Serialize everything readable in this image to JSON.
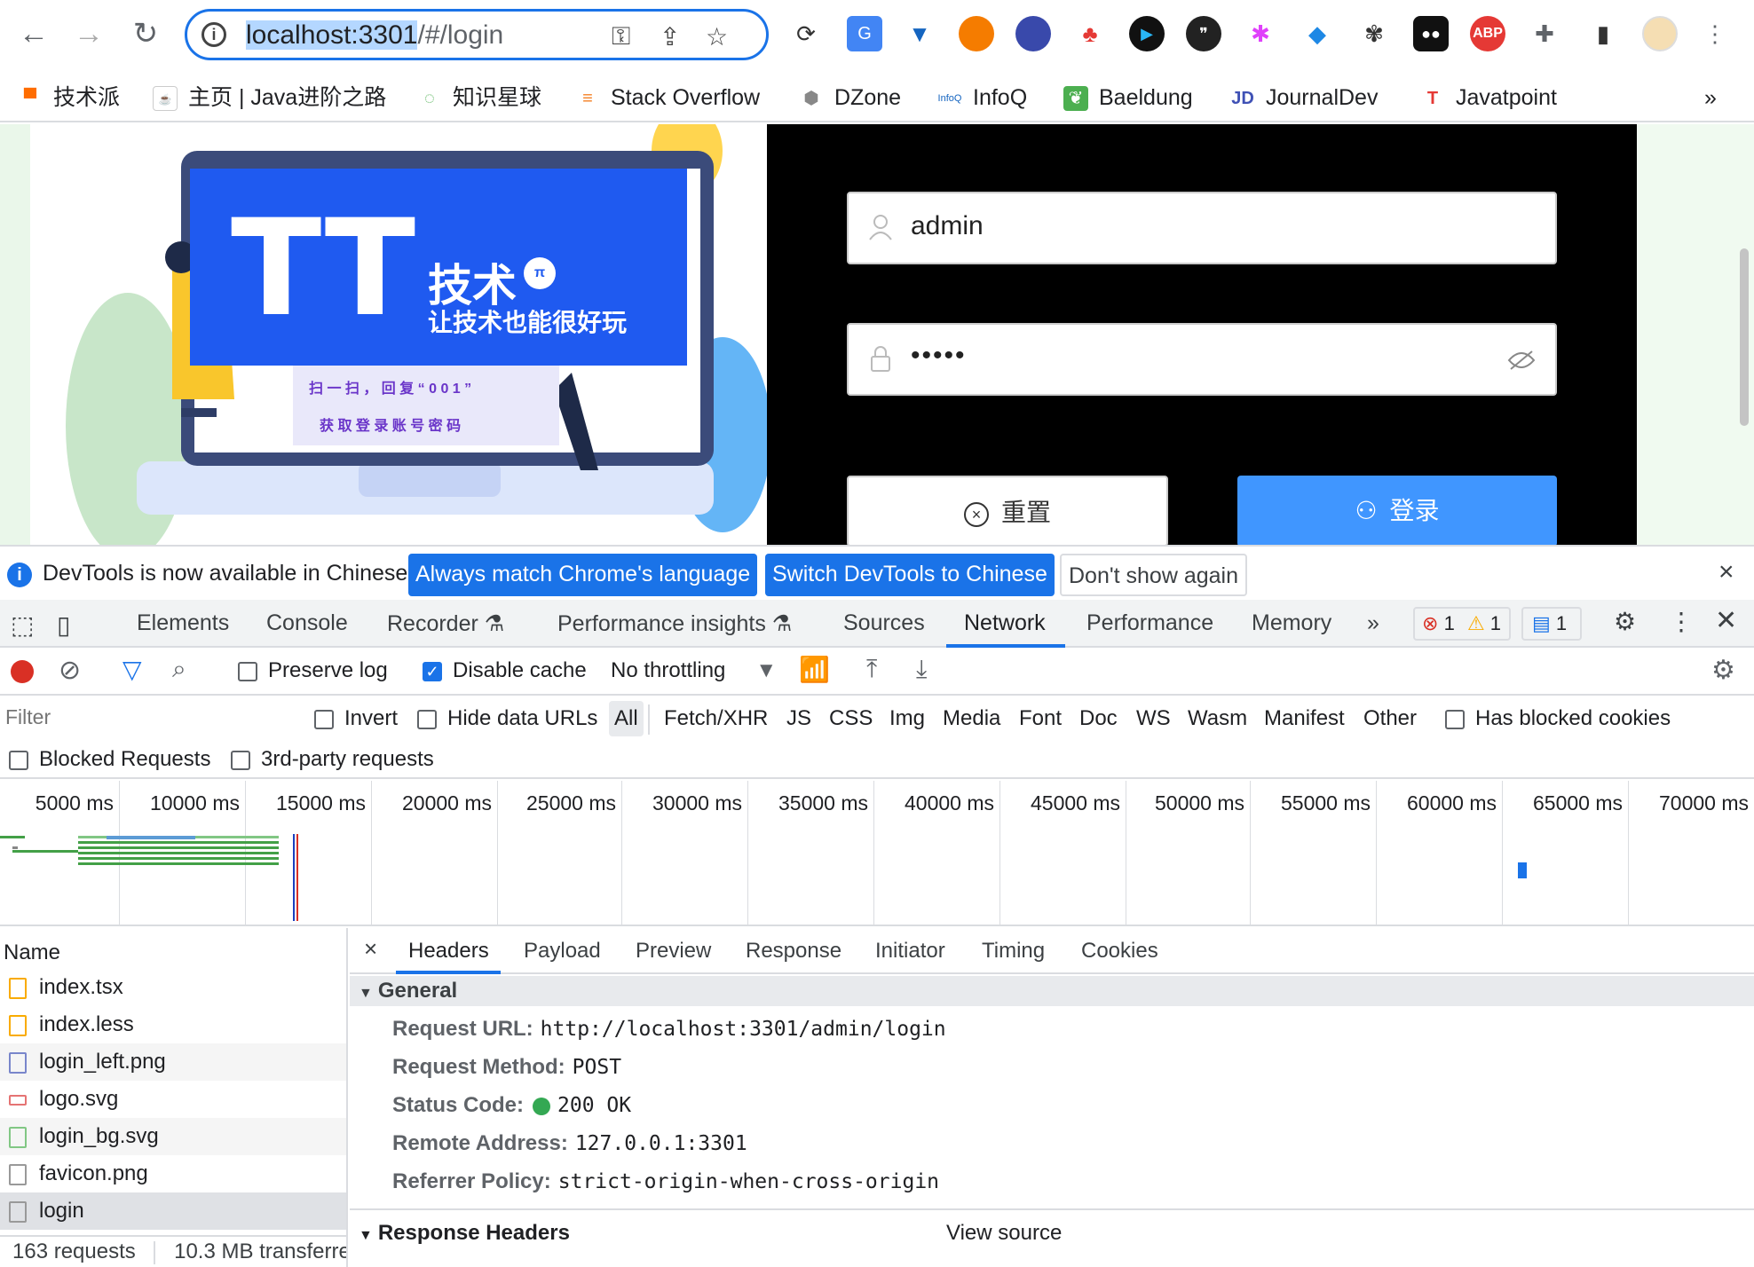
{
  "browser": {
    "url_host": "localhost:3301",
    "url_path": "/#/login",
    "bookmarks": [
      "技术派",
      "主页 | Java进阶之路",
      "知识星球",
      "Stack Overflow",
      "DZone",
      "InfoQ",
      "Baeldung",
      "JournalDev",
      "Javatpoint"
    ],
    "bookmarks_more": "»"
  },
  "page": {
    "brand_sub": "技术",
    "slogan": "让技术也能很好玩",
    "scan_line1": "扫 一 扫 ， 回 复 “ 0 0 1 ”",
    "scan_line2": "获 取 登 录 账 号 密 码",
    "username_value": "admin",
    "password_mask": "•••••",
    "reset_label": "重置",
    "login_label": "登录"
  },
  "notice": {
    "text": "DevTools is now available in Chinese!",
    "btn_match": "Always match Chrome's language",
    "btn_switch": "Switch DevTools to Chinese",
    "btn_dismiss": "Don't show again",
    "close": "×"
  },
  "devtools": {
    "tabs": [
      "Elements",
      "Console",
      "Recorder",
      "Performance insights",
      "Sources",
      "Network",
      "Performance",
      "Memory"
    ],
    "active_tab": "Network",
    "more": "»",
    "errors": "1",
    "warnings": "1",
    "messages": "1",
    "toolbar": {
      "preserve_log": "Preserve log",
      "disable_cache": "Disable cache",
      "throttling": "No throttling"
    },
    "filter": {
      "placeholder": "Filter",
      "invert": "Invert",
      "hide_data_urls": "Hide data URLs",
      "types": [
        "All",
        "Fetch/XHR",
        "JS",
        "CSS",
        "Img",
        "Media",
        "Font",
        "Doc",
        "WS",
        "Wasm",
        "Manifest",
        "Other"
      ],
      "has_blocked_cookies": "Has blocked cookies",
      "blocked_requests": "Blocked Requests",
      "third_party": "3rd-party requests"
    },
    "timeline_ticks": [
      "5000 ms",
      "10000 ms",
      "15000 ms",
      "20000 ms",
      "25000 ms",
      "30000 ms",
      "35000 ms",
      "40000 ms",
      "45000 ms",
      "50000 ms",
      "55000 ms",
      "60000 ms",
      "65000 ms",
      "70000 ms"
    ],
    "requests": {
      "header": "Name",
      "items": [
        "index.tsx",
        "index.less",
        "login_left.png",
        "logo.svg",
        "login_bg.svg",
        "favicon.png",
        "login"
      ],
      "summary_count": "163 requests",
      "summary_size": "10.3 MB transferre"
    },
    "detail_tabs": [
      "Headers",
      "Payload",
      "Preview",
      "Response",
      "Initiator",
      "Timing",
      "Cookies"
    ],
    "detail_close": "×",
    "general": {
      "title": "General",
      "request_url_label": "Request URL:",
      "request_url": "http://localhost:3301/admin/login",
      "method_label": "Request Method:",
      "method": "POST",
      "status_label": "Status Code:",
      "status": "200 OK",
      "remote_label": "Remote Address:",
      "remote": "127.0.0.1:3301",
      "referrer_label": "Referrer Policy:",
      "referrer": "strict-origin-when-cross-origin"
    },
    "response_headers": {
      "title": "Response Headers",
      "view_source": "View source"
    }
  },
  "colors": {
    "accent": "#1a73e8",
    "login_btn": "#4096ff",
    "brand_blue": "#1f5af0"
  }
}
